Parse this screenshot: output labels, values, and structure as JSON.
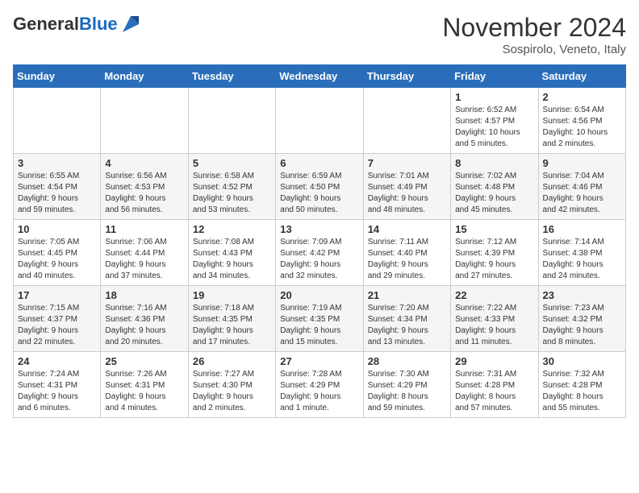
{
  "header": {
    "logo_line1": "General",
    "logo_line2": "Blue",
    "month": "November 2024",
    "location": "Sospirolo, Veneto, Italy"
  },
  "days_of_week": [
    "Sunday",
    "Monday",
    "Tuesday",
    "Wednesday",
    "Thursday",
    "Friday",
    "Saturday"
  ],
  "weeks": [
    [
      {
        "day": "",
        "info": ""
      },
      {
        "day": "",
        "info": ""
      },
      {
        "day": "",
        "info": ""
      },
      {
        "day": "",
        "info": ""
      },
      {
        "day": "",
        "info": ""
      },
      {
        "day": "1",
        "info": "Sunrise: 6:52 AM\nSunset: 4:57 PM\nDaylight: 10 hours\nand 5 minutes."
      },
      {
        "day": "2",
        "info": "Sunrise: 6:54 AM\nSunset: 4:56 PM\nDaylight: 10 hours\nand 2 minutes."
      }
    ],
    [
      {
        "day": "3",
        "info": "Sunrise: 6:55 AM\nSunset: 4:54 PM\nDaylight: 9 hours\nand 59 minutes."
      },
      {
        "day": "4",
        "info": "Sunrise: 6:56 AM\nSunset: 4:53 PM\nDaylight: 9 hours\nand 56 minutes."
      },
      {
        "day": "5",
        "info": "Sunrise: 6:58 AM\nSunset: 4:52 PM\nDaylight: 9 hours\nand 53 minutes."
      },
      {
        "day": "6",
        "info": "Sunrise: 6:59 AM\nSunset: 4:50 PM\nDaylight: 9 hours\nand 50 minutes."
      },
      {
        "day": "7",
        "info": "Sunrise: 7:01 AM\nSunset: 4:49 PM\nDaylight: 9 hours\nand 48 minutes."
      },
      {
        "day": "8",
        "info": "Sunrise: 7:02 AM\nSunset: 4:48 PM\nDaylight: 9 hours\nand 45 minutes."
      },
      {
        "day": "9",
        "info": "Sunrise: 7:04 AM\nSunset: 4:46 PM\nDaylight: 9 hours\nand 42 minutes."
      }
    ],
    [
      {
        "day": "10",
        "info": "Sunrise: 7:05 AM\nSunset: 4:45 PM\nDaylight: 9 hours\nand 40 minutes."
      },
      {
        "day": "11",
        "info": "Sunrise: 7:06 AM\nSunset: 4:44 PM\nDaylight: 9 hours\nand 37 minutes."
      },
      {
        "day": "12",
        "info": "Sunrise: 7:08 AM\nSunset: 4:43 PM\nDaylight: 9 hours\nand 34 minutes."
      },
      {
        "day": "13",
        "info": "Sunrise: 7:09 AM\nSunset: 4:42 PM\nDaylight: 9 hours\nand 32 minutes."
      },
      {
        "day": "14",
        "info": "Sunrise: 7:11 AM\nSunset: 4:40 PM\nDaylight: 9 hours\nand 29 minutes."
      },
      {
        "day": "15",
        "info": "Sunrise: 7:12 AM\nSunset: 4:39 PM\nDaylight: 9 hours\nand 27 minutes."
      },
      {
        "day": "16",
        "info": "Sunrise: 7:14 AM\nSunset: 4:38 PM\nDaylight: 9 hours\nand 24 minutes."
      }
    ],
    [
      {
        "day": "17",
        "info": "Sunrise: 7:15 AM\nSunset: 4:37 PM\nDaylight: 9 hours\nand 22 minutes."
      },
      {
        "day": "18",
        "info": "Sunrise: 7:16 AM\nSunset: 4:36 PM\nDaylight: 9 hours\nand 20 minutes."
      },
      {
        "day": "19",
        "info": "Sunrise: 7:18 AM\nSunset: 4:35 PM\nDaylight: 9 hours\nand 17 minutes."
      },
      {
        "day": "20",
        "info": "Sunrise: 7:19 AM\nSunset: 4:35 PM\nDaylight: 9 hours\nand 15 minutes."
      },
      {
        "day": "21",
        "info": "Sunrise: 7:20 AM\nSunset: 4:34 PM\nDaylight: 9 hours\nand 13 minutes."
      },
      {
        "day": "22",
        "info": "Sunrise: 7:22 AM\nSunset: 4:33 PM\nDaylight: 9 hours\nand 11 minutes."
      },
      {
        "day": "23",
        "info": "Sunrise: 7:23 AM\nSunset: 4:32 PM\nDaylight: 9 hours\nand 8 minutes."
      }
    ],
    [
      {
        "day": "24",
        "info": "Sunrise: 7:24 AM\nSunset: 4:31 PM\nDaylight: 9 hours\nand 6 minutes."
      },
      {
        "day": "25",
        "info": "Sunrise: 7:26 AM\nSunset: 4:31 PM\nDaylight: 9 hours\nand 4 minutes."
      },
      {
        "day": "26",
        "info": "Sunrise: 7:27 AM\nSunset: 4:30 PM\nDaylight: 9 hours\nand 2 minutes."
      },
      {
        "day": "27",
        "info": "Sunrise: 7:28 AM\nSunset: 4:29 PM\nDaylight: 9 hours\nand 1 minute."
      },
      {
        "day": "28",
        "info": "Sunrise: 7:30 AM\nSunset: 4:29 PM\nDaylight: 8 hours\nand 59 minutes."
      },
      {
        "day": "29",
        "info": "Sunrise: 7:31 AM\nSunset: 4:28 PM\nDaylight: 8 hours\nand 57 minutes."
      },
      {
        "day": "30",
        "info": "Sunrise: 7:32 AM\nSunset: 4:28 PM\nDaylight: 8 hours\nand 55 minutes."
      }
    ]
  ]
}
